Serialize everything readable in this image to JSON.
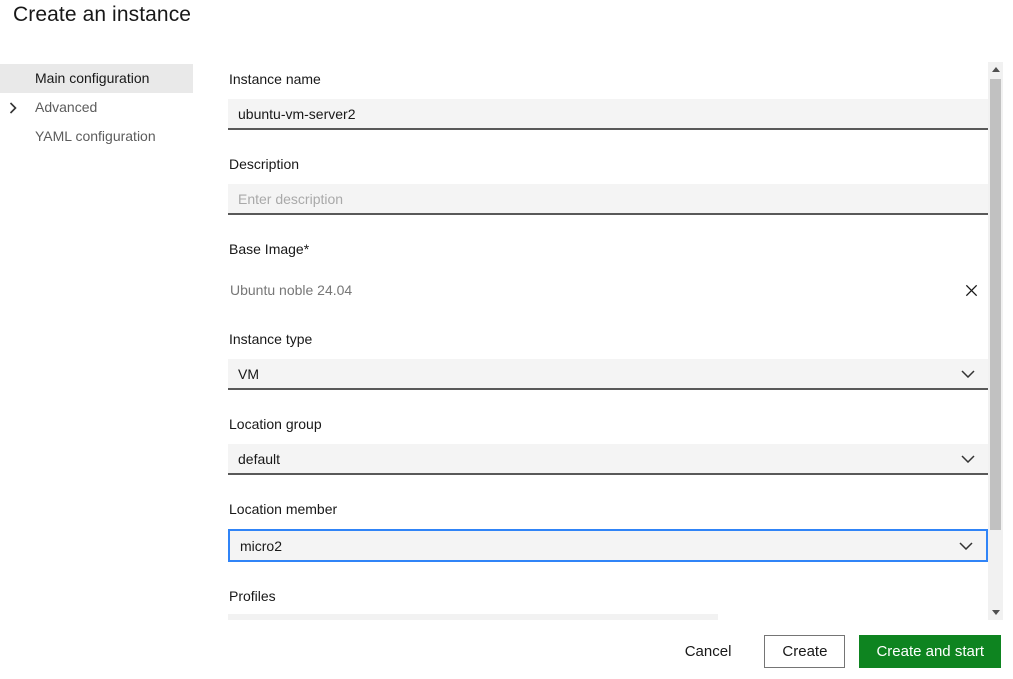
{
  "page_title": "Create an instance",
  "sidebar": {
    "items": [
      {
        "label": "Main configuration",
        "selected": true,
        "expandable": false
      },
      {
        "label": "Advanced",
        "selected": false,
        "expandable": true
      },
      {
        "label": "YAML configuration",
        "selected": false,
        "expandable": false
      }
    ]
  },
  "form": {
    "instance_name": {
      "label": "Instance name",
      "value": "ubuntu-vm-server2"
    },
    "description": {
      "label": "Description",
      "placeholder": "Enter description"
    },
    "base_image": {
      "label": "Base Image*",
      "value": "Ubuntu noble 24.04"
    },
    "instance_type": {
      "label": "Instance type",
      "value": "VM"
    },
    "location_group": {
      "label": "Location group",
      "value": "default"
    },
    "location_member": {
      "label": "Location member",
      "value": "micro2",
      "focused": true
    },
    "profiles": {
      "label": "Profiles"
    }
  },
  "footer": {
    "cancel_label": "Cancel",
    "create_label": "Create",
    "create_and_start_label": "Create and start"
  },
  "icons": {
    "sidebar_advanced": "chevron-right-icon",
    "select_dropdown": "chevron-down-icon",
    "base_image_clear": "x-icon",
    "scrollbar_up": "triangle-up-icon",
    "scrollbar_down": "triangle-down-icon"
  },
  "colors": {
    "accent_green": "#0e8420",
    "focus_blue": "#3084f7",
    "input_bg": "#f4f4f4",
    "input_border": "#595959",
    "sidebar_selected_bg": "#e9e9e9",
    "muted_text": "#777777",
    "scrollbar_thumb": "#c1c1c1"
  }
}
